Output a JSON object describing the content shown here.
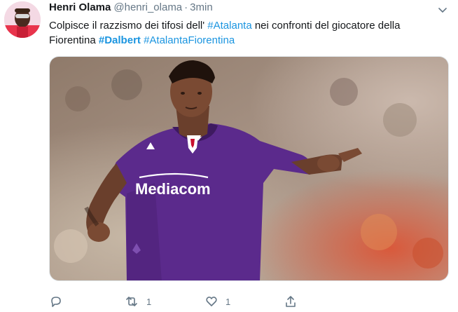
{
  "author": {
    "name": "Henri Olama",
    "handle": "@henri_olama",
    "separator": "·",
    "time": "3min"
  },
  "tweet": {
    "segments_line1": [
      {
        "text": "Colpisce il razzismo dei tifosi dell' ",
        "type": "text"
      },
      {
        "text": "#Atalanta",
        "type": "hashtag"
      },
      {
        "text": " nei confronti del giocatore della",
        "type": "text"
      }
    ],
    "segments_line2": [
      {
        "text": "Fiorentina ",
        "type": "text"
      },
      {
        "text": "#Dalbert",
        "type": "hashtag-bold"
      },
      {
        "text": " ",
        "type": "text"
      },
      {
        "text": "#AtalantaFiorentina",
        "type": "hashtag"
      }
    ]
  },
  "media": {
    "jersey_sponsor": "Mediacom",
    "jersey_color": "#5b2a8c"
  },
  "actions": {
    "reply_count": "",
    "retweet_count": "1",
    "like_count": "1",
    "share_count": ""
  },
  "icons": {
    "more": "chevron-down-icon",
    "reply": "reply-icon",
    "retweet": "retweet-icon",
    "like": "heart-icon",
    "share": "share-icon"
  },
  "colors": {
    "text": "#14171a",
    "muted": "#657786",
    "link": "#1b95e0",
    "border": "#e1e8ed"
  }
}
